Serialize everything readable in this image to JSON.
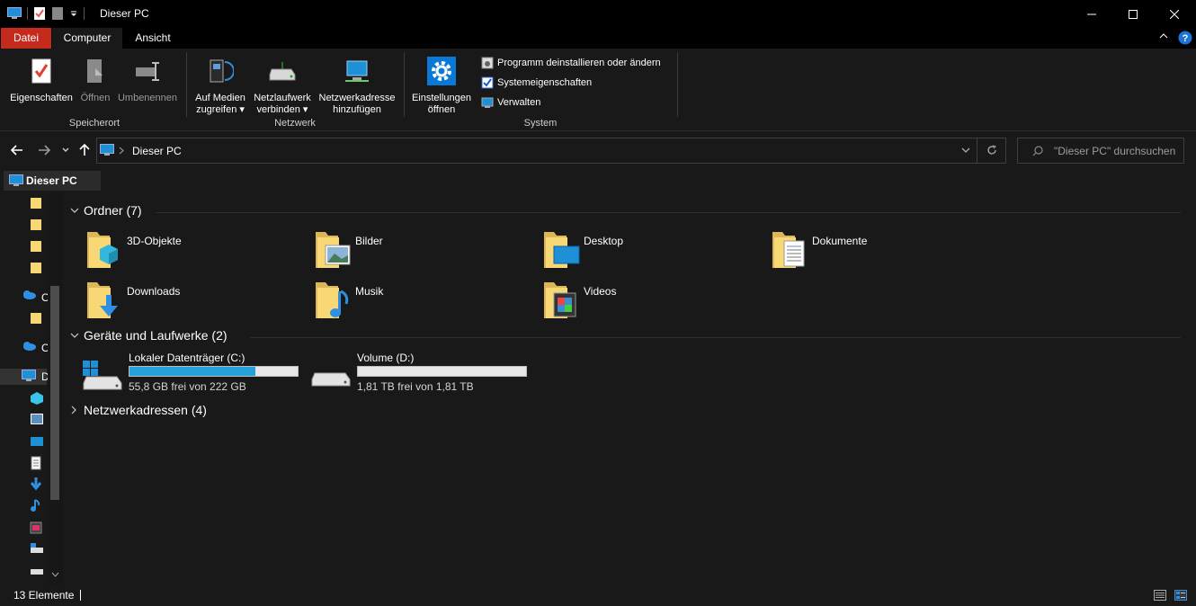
{
  "window": {
    "title": "Dieser PC",
    "controls": [
      "minimize",
      "maximize",
      "close"
    ]
  },
  "ribbon_tabs": [
    "Datei",
    "Computer",
    "Ansicht"
  ],
  "ribbon": {
    "groups": [
      {
        "label": "Speicherort",
        "buttons": [
          "Eigenschaften",
          "Öffnen",
          "Umbenennen"
        ]
      },
      {
        "label": "Netzwerk",
        "buttons": [
          {
            "line1": "Auf Medien",
            "line2": "zugreifen"
          },
          {
            "line1": "Netzlaufwerk",
            "line2": "verbinden"
          },
          {
            "line1": "Netzwerkadresse",
            "line2": "hinzufügen"
          }
        ]
      },
      {
        "label": "System",
        "buttons": [
          {
            "line1": "Einstellungen",
            "line2": "öffnen"
          }
        ],
        "small_commands": [
          "Programm deinstallieren oder ändern",
          "Systemeigenschaften",
          "Verwalten"
        ]
      }
    ]
  },
  "address": {
    "path": "Dieser PC",
    "search_placeholder": "\"Dieser PC\" durchsuchen"
  },
  "nav_tab": "Dieser PC",
  "nav_pane": {
    "partial_labels": [
      "O",
      "O",
      "D"
    ]
  },
  "content": {
    "folders_header": "Ordner (7)",
    "folders": [
      "3D-Objekte",
      "Bilder",
      "Desktop",
      "Dokumente",
      "Downloads",
      "Musik",
      "Videos"
    ],
    "drives_header": "Geräte und Laufwerke (2)",
    "drives": [
      {
        "name": "Lokaler Datenträger (C:)",
        "free_text": "55,8 GB frei von 222 GB",
        "used_fraction": 0.749
      },
      {
        "name": "Volume (D:)",
        "free_text": "1,81 TB frei von 1,81 TB",
        "used_fraction": 0.0
      }
    ],
    "network_header": "Netzwerkadressen (4)"
  },
  "status": {
    "item_count": "13 Elemente"
  },
  "colors": {
    "accent_blue": "#26a0da",
    "datei_tab": "#c42b1c",
    "folder_yellow": "#f8d775",
    "background": "#191919"
  }
}
